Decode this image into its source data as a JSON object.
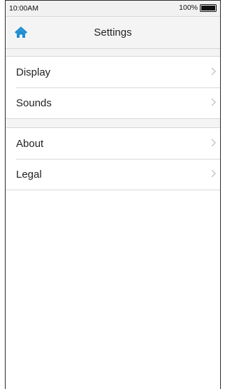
{
  "status_bar": {
    "time": "10:00AM",
    "battery_percent_label": "100%",
    "battery_level": 1.0
  },
  "nav": {
    "title": "Settings",
    "home_icon": "home-icon",
    "accent_color": "#1f8fd1"
  },
  "groups": [
    {
      "items": [
        {
          "label": "Display",
          "icon": "chevron-right-icon"
        },
        {
          "label": "Sounds",
          "icon": "chevron-right-icon"
        }
      ]
    },
    {
      "items": [
        {
          "label": "About",
          "icon": "chevron-right-icon"
        },
        {
          "label": "Legal",
          "icon": "chevron-right-icon"
        }
      ]
    }
  ]
}
